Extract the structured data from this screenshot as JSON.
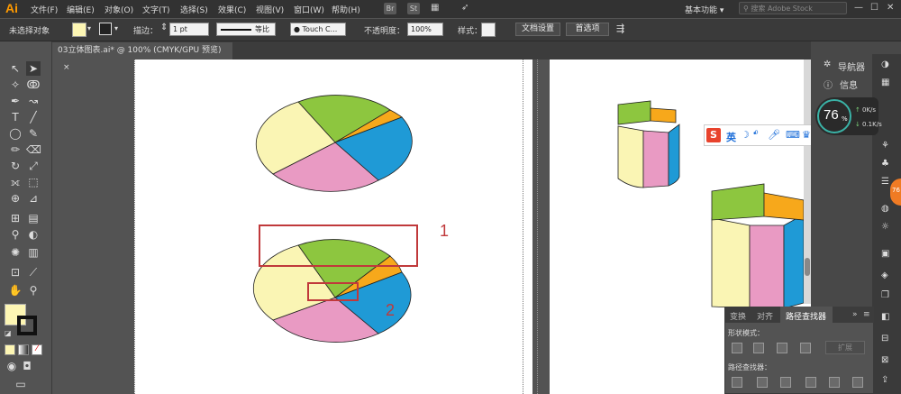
{
  "app": {
    "logo": "Ai"
  },
  "menu": [
    "文件(F)",
    "编辑(E)",
    "对象(O)",
    "文字(T)",
    "选择(S)",
    "效果(C)",
    "视图(V)",
    "窗口(W)",
    "帮助(H)"
  ],
  "bridge_buttons": [
    "Br",
    "St"
  ],
  "workspace": "基本功能",
  "search": {
    "placeholder": "搜索 Adobe Stock"
  },
  "control": {
    "selection_label": "未选择对象",
    "stroke_label": "描边：",
    "stroke_value": "1 pt",
    "line_style": "等比",
    "brush": "Touch C...",
    "opacity_label": "不透明度：",
    "opacity_value": "100%",
    "style_label": "样式：",
    "doc_setup": "文档设置",
    "preferences": "首选项"
  },
  "tab": {
    "title": "03立体图表.ai* @ 100% (CMYK/GPU 预览)",
    "close": "×"
  },
  "right_panel": {
    "navigator": "导航器",
    "info": "信息",
    "speed_percent": "76",
    "speed_unit": "%",
    "upload": "0K/s",
    "download": "0.1K/s",
    "badge": "76"
  },
  "ime": {
    "logo": "S",
    "lang": "英"
  },
  "pathfinder": {
    "tabs": [
      "变换",
      "对齐",
      "路径查找器"
    ],
    "shape_modes_label": "形状模式：",
    "expand": "扩展",
    "pathfinders_label": "路径查找器："
  },
  "annotations": {
    "box1": "1",
    "box2": "2"
  },
  "colors": {
    "green": "#8dc63f",
    "orange": "#f7a81b",
    "blue": "#1f9ad6",
    "pink": "#e99ac3",
    "yellow": "#faf5b4",
    "annotation": "#c0393b",
    "fill_swatch": "#fdf6b4"
  }
}
